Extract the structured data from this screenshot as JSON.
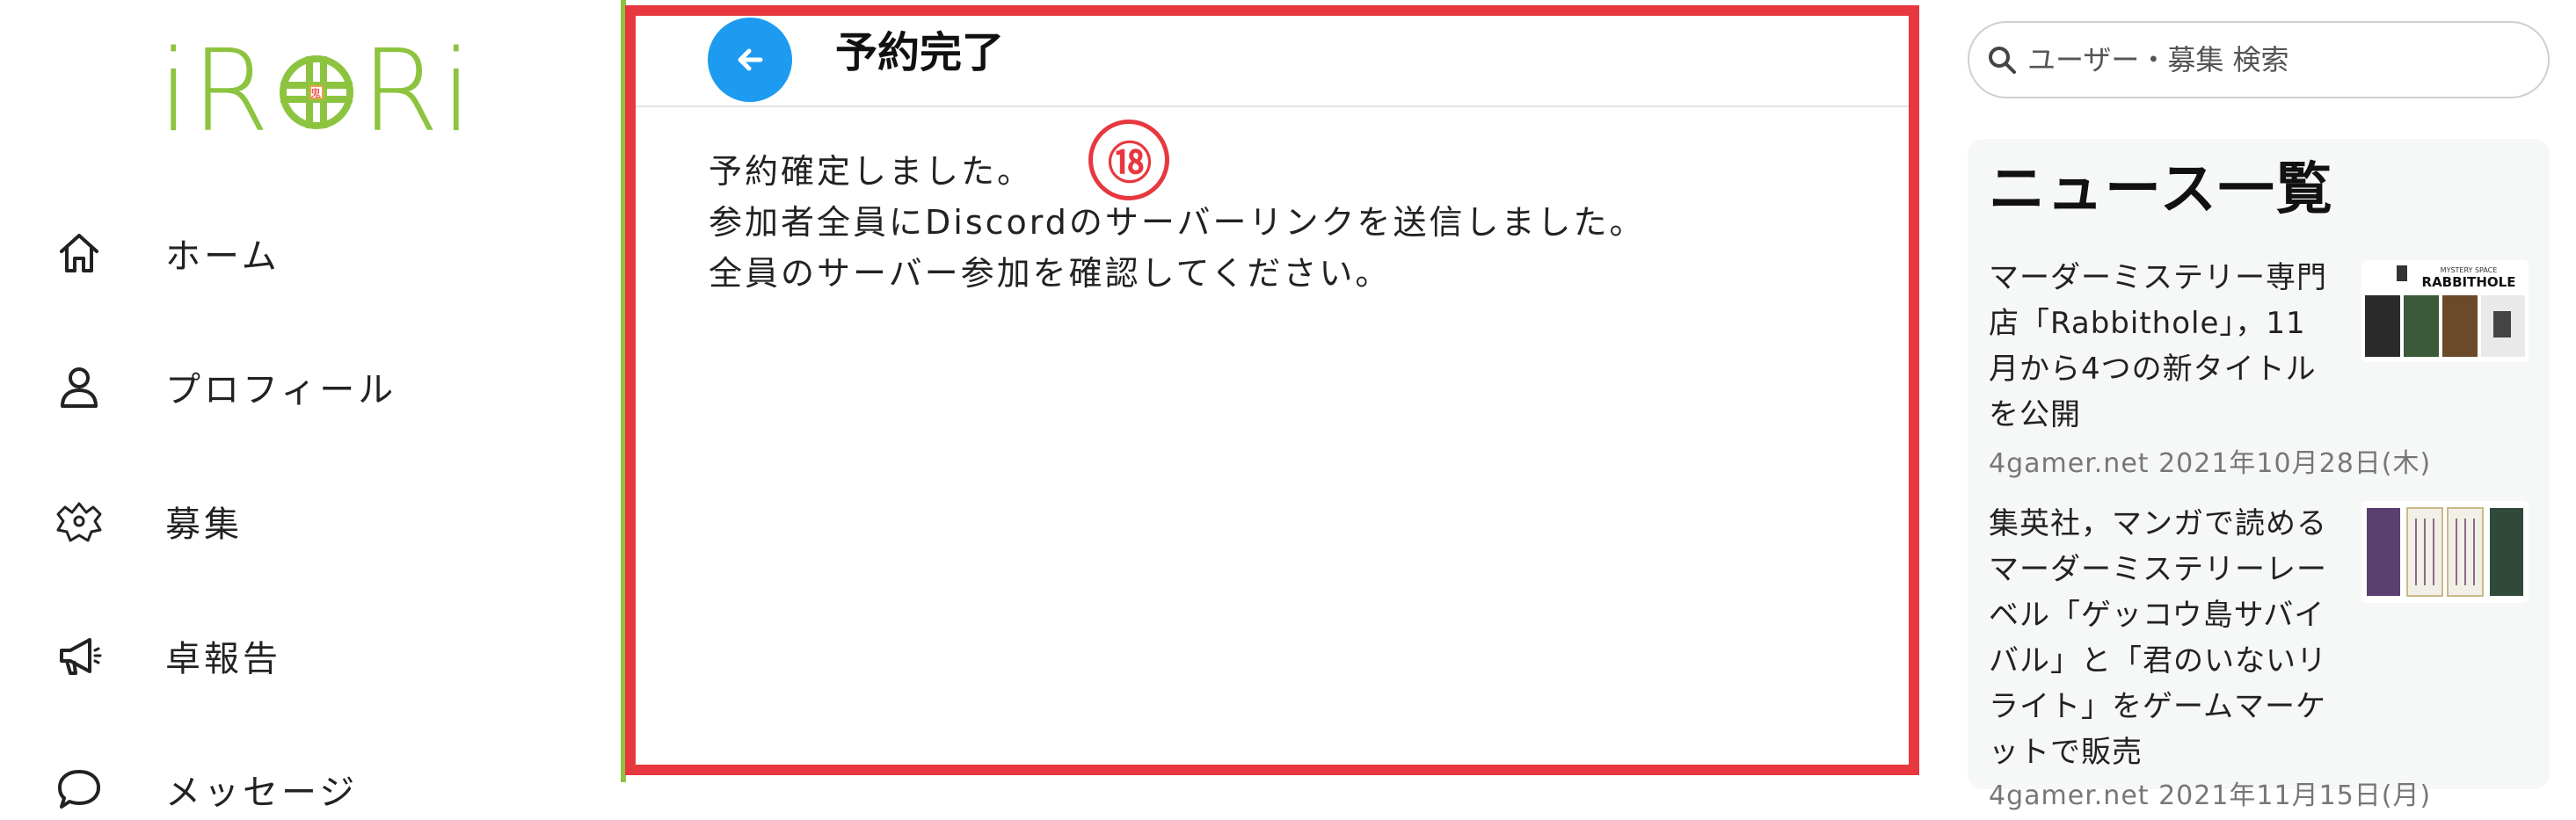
{
  "logo": {
    "text_left": "iR",
    "text_right": "Ri",
    "mark_text": "鬼"
  },
  "sidebar": {
    "items": [
      {
        "label": "ホーム",
        "icon": "home-icon"
      },
      {
        "label": "プロフィール",
        "icon": "user-icon"
      },
      {
        "label": "募集",
        "icon": "puzzle-people-icon"
      },
      {
        "label": "卓報告",
        "icon": "megaphone-icon"
      },
      {
        "label": "メッセージ",
        "icon": "chat-bubble-icon"
      }
    ]
  },
  "main": {
    "title": "予約完了",
    "back_icon": "arrow-left-icon",
    "messages": [
      "予約確定しました。",
      "参加者全員にDiscordのサーバーリンクを送信しました。",
      "全員のサーバー参加を確認してください。"
    ],
    "annotation": "⑱"
  },
  "search": {
    "placeholder": "ユーザー・募集 検索",
    "icon": "search-icon"
  },
  "news": {
    "title": "ニュース一覧",
    "items": [
      {
        "lines": [
          "マーダーミステリー専門",
          "店「Rabbithole」，11",
          "月から4つの新タイトル",
          "を公開"
        ],
        "meta": "4gamer.net 2021年10月28日(木)",
        "thumb_caption": "RABBITHOLE"
      },
      {
        "lines": [
          "集英社，マンガで読める",
          "マーダーミステリーレー",
          "ベル「ゲッコウ島サバイ",
          "バル」と「君のいないリ",
          "ライト」をゲームマーケ",
          "ットで販売"
        ],
        "meta": "4gamer.net 2021年11月15日(月)",
        "thumb_caption": ""
      }
    ]
  },
  "colors": {
    "accent": "#8cc43f",
    "frame": "#e8383f",
    "primary": "#1d9bf0"
  }
}
